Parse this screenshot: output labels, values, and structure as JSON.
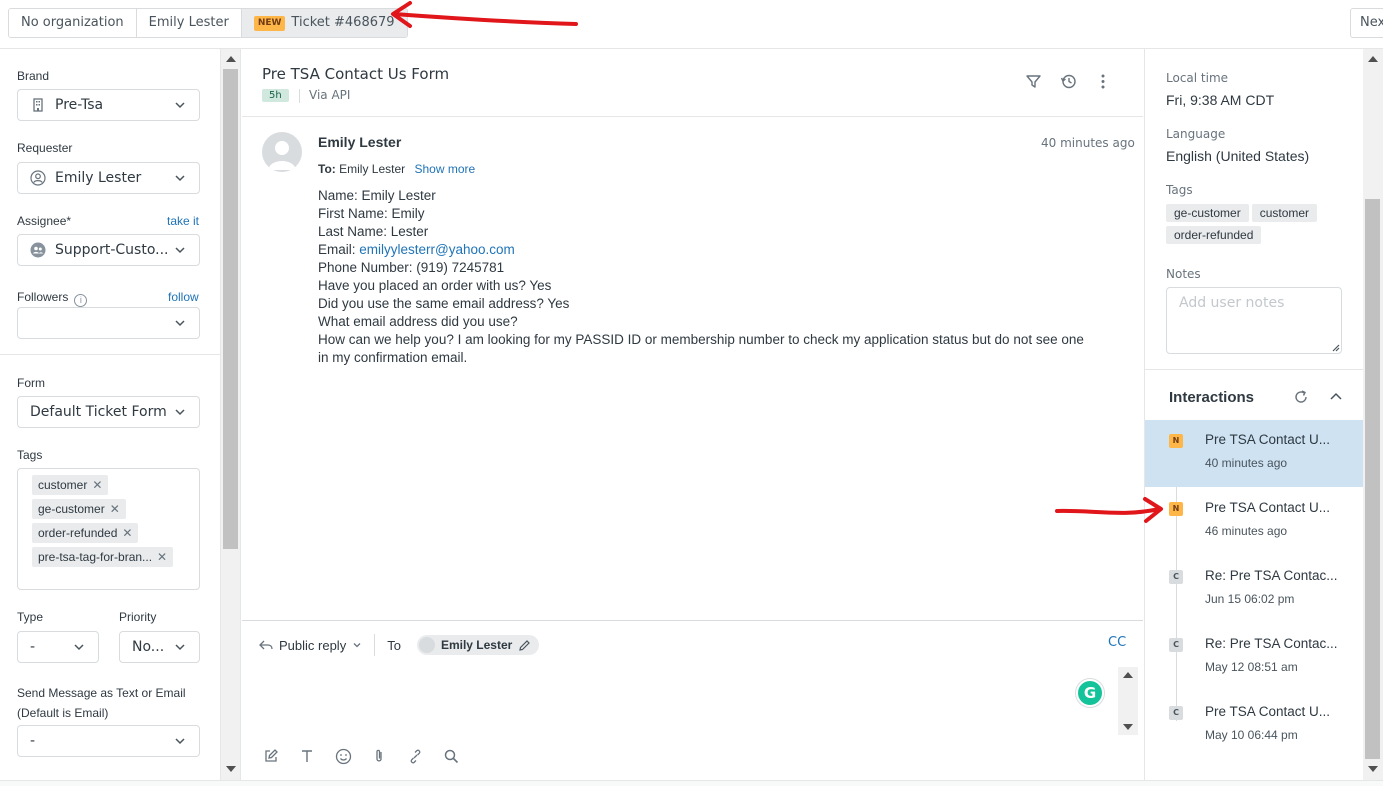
{
  "breadcrumbs": {
    "organization": "No organization",
    "requester": "Emily Lester",
    "status_badge": "NEW",
    "ticket": "Ticket #468679"
  },
  "next_label": "Next",
  "colors": {
    "annotation": "#e0161b",
    "link": "#1f73b7",
    "new_badge": "#ffb648",
    "selected": "#cee2f2"
  },
  "left_panel": {
    "brand": {
      "label": "Brand",
      "value": "Pre-Tsa",
      "icon": "building-icon"
    },
    "requester": {
      "label": "Requester",
      "value": "Emily Lester",
      "icon": "user-icon"
    },
    "assignee": {
      "label": "Assignee*",
      "action": "take it",
      "value": "Support-Custo...",
      "icon": "group-icon"
    },
    "followers": {
      "label": "Followers",
      "action": "follow",
      "value": ""
    },
    "form": {
      "label": "Form",
      "value": "Default Ticket Form"
    },
    "tags": {
      "label": "Tags",
      "items": [
        "customer",
        "ge-customer",
        "order-refunded",
        "pre-tsa-tag-for-bran..."
      ]
    },
    "type": {
      "label": "Type",
      "value": "-"
    },
    "priority": {
      "label": "Priority",
      "value": "No..."
    },
    "send_message": {
      "label_line1": "Send Message as Text or Email",
      "label_line2": "(Default is Email)",
      "value": "-"
    }
  },
  "ticket": {
    "title": "Pre TSA Contact Us Form",
    "age": "5h",
    "via": "Via API"
  },
  "message": {
    "author": "Emily Lester",
    "time": "40 minutes ago",
    "to_label": "To:",
    "to_value": "Emily Lester",
    "show_more": "Show more",
    "lines": [
      "Name: Emily Lester",
      "First Name: Emily",
      "Last Name: Lester"
    ],
    "email_label": "Email: ",
    "email": "emilyylesterr@yahoo.com",
    "lines2": [
      "Phone Number: (919) 7245781",
      "Have you placed an order with us? Yes",
      "Did you use the same email address? Yes",
      "What email address did you use?",
      "How can we help you? I am looking for my PASSID ID or membership number to check my application status but do not see one",
      "in my confirmation email."
    ]
  },
  "reply": {
    "type": "Public reply",
    "to_label": "To",
    "to_chip": "Emily Lester",
    "cc": "CC",
    "grammarly": "G"
  },
  "right_panel": {
    "local_time_label": "Local time",
    "local_time": "Fri, 9:38 AM CDT",
    "language_label": "Language",
    "language": "English (United States)",
    "tags_label": "Tags",
    "tags": [
      "ge-customer",
      "customer",
      "order-refunded"
    ],
    "notes_label": "Notes",
    "notes_placeholder": "Add user notes",
    "interactions_title": "Interactions",
    "interactions": [
      {
        "badge": "N",
        "status": "new",
        "title": "Pre TSA Contact U...",
        "time": "40 minutes ago",
        "selected": true
      },
      {
        "badge": "N",
        "status": "new",
        "title": "Pre TSA Contact U...",
        "time": "46 minutes ago",
        "selected": false
      },
      {
        "badge": "C",
        "status": "closed",
        "title": "Re: Pre TSA Contac...",
        "time": "Jun 15 06:02 pm",
        "selected": false
      },
      {
        "badge": "C",
        "status": "closed",
        "title": "Re: Pre TSA Contac...",
        "time": "May 12 08:51 am",
        "selected": false
      },
      {
        "badge": "C",
        "status": "closed",
        "title": "Pre TSA Contact U...",
        "time": "May 10 06:44 pm",
        "selected": false
      }
    ]
  }
}
